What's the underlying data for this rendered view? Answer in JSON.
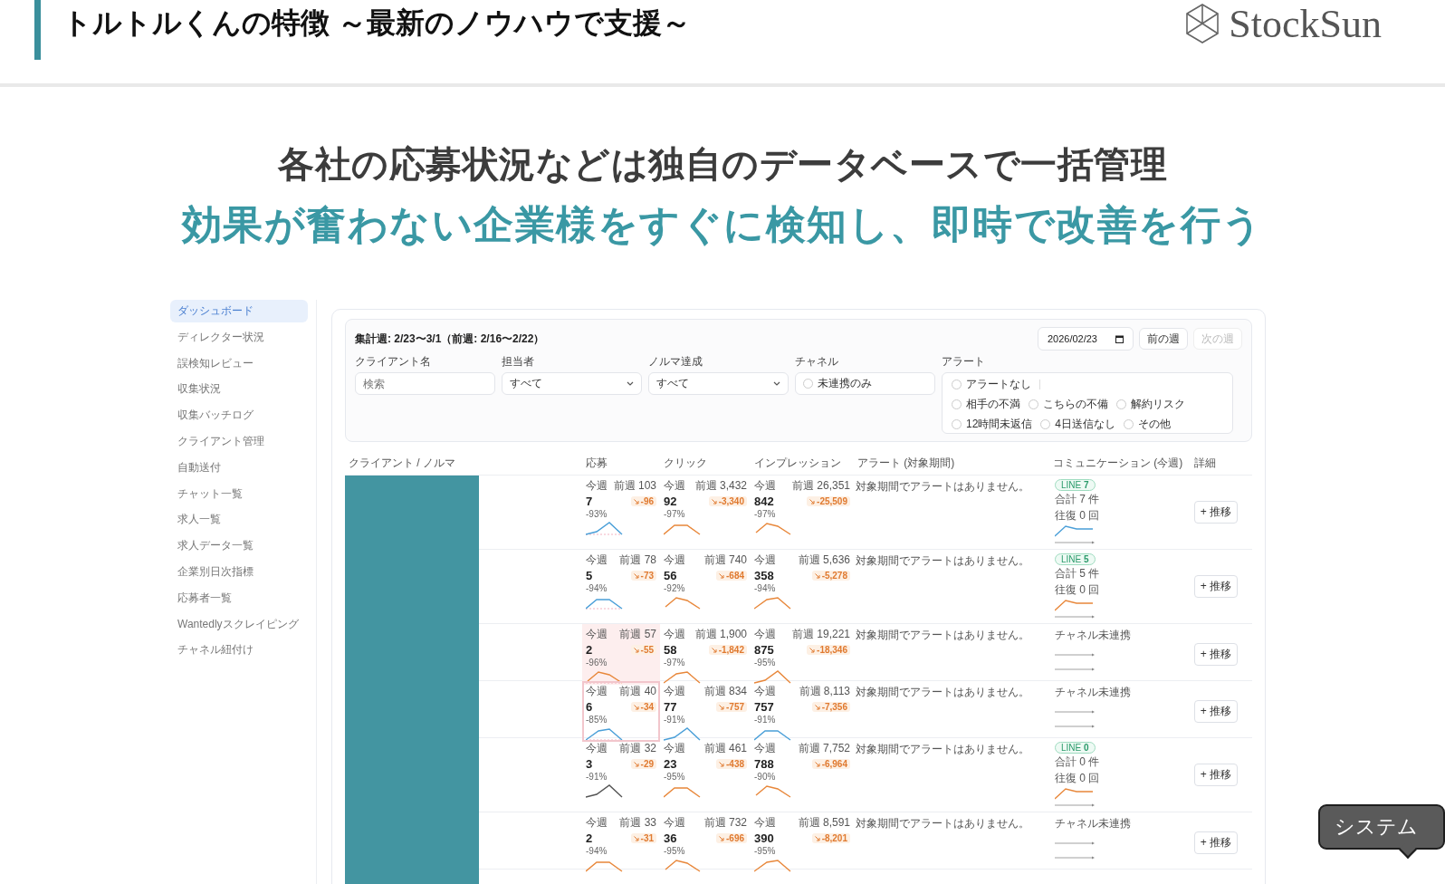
{
  "header": {
    "title": "トルトルくんの特徴 ～最新のノウハウで支援～",
    "logo": "StockSun"
  },
  "headline": {
    "line_1": "各社の応募状況などは独自のデータベースで一括管理",
    "line_2": "効果が奮わない企業様をすぐに検知し、即時で改善を行う"
  },
  "sidebar": {
    "items": [
      {
        "label": "ダッシュボード",
        "selected": true
      },
      {
        "label": "ディレクター状況",
        "selected": false
      },
      {
        "label": "誤検知レビュー",
        "selected": false
      },
      {
        "label": "収集状況",
        "selected": false
      },
      {
        "label": "収集バッチログ",
        "selected": false
      },
      {
        "label": "クライアント管理",
        "selected": false
      },
      {
        "label": "自動送付",
        "selected": false
      },
      {
        "label": "チャット一覧",
        "selected": false
      },
      {
        "label": "求人一覧",
        "selected": false
      },
      {
        "label": "求人データ一覧",
        "selected": false
      },
      {
        "label": "企業別日次指標",
        "selected": false
      },
      {
        "label": "応募者一覧",
        "selected": false
      },
      {
        "label": "Wantedlyスクレイピング",
        "selected": false
      },
      {
        "label": "チャネル紐付け",
        "selected": false
      }
    ]
  },
  "filters": {
    "period": "集計週: 2/23〜3/1（前週: 2/16〜2/22）",
    "date": "2026/02/23",
    "week_buttons": [
      {
        "label": "前の週",
        "disabled": false
      },
      {
        "label": "次の週",
        "disabled": true
      }
    ],
    "client_name": {
      "label": "クライアント名",
      "placeholder": "検索"
    },
    "owner": {
      "label": "担当者",
      "value": "すべて"
    },
    "quota": {
      "label": "ノルマ達成",
      "value": "すべて"
    },
    "channel": {
      "label": "チャネル",
      "option": {
        "label": "未連携のみ",
        "checked": false
      }
    },
    "alert": {
      "label": "アラート",
      "rows": [
        [
          {
            "label": "アラートなし",
            "checked": false
          }
        ],
        [
          {
            "label": "相手の不満",
            "checked": false
          },
          {
            "label": "こちらの不備",
            "checked": false
          },
          {
            "label": "解約リスク",
            "checked": false
          }
        ],
        [
          {
            "label": "12時間未返信",
            "checked": false
          },
          {
            "label": "4日送信なし",
            "checked": false
          },
          {
            "label": "その他",
            "checked": false
          }
        ]
      ]
    }
  },
  "table": {
    "columns": [
      "クライアント / ノルマ",
      "応募",
      "クリック",
      "インプレッション",
      "アラート (対象期間)",
      "コミュニケーション (今週)",
      "詳細"
    ],
    "rows": [
      {
        "metrics": [
          {
            "this_week": "今週",
            "prev": "前週 103",
            "value": "7",
            "delta": "-96",
            "pct": "-93%",
            "color": "#4a9fd8",
            "flagged": false,
            "selected": false
          },
          {
            "this_week": "今週",
            "prev": "前週 3,432",
            "value": "92",
            "delta": "-3,340",
            "pct": "-97%",
            "color": "#e8873a",
            "flagged": false,
            "selected": false
          },
          {
            "this_week": "今週",
            "prev": "前週 26,351",
            "value": "842",
            "delta": "-25,509",
            "pct": "-97%",
            "color": "#e8873a",
            "flagged": false,
            "selected": false
          }
        ],
        "alert": "対象期間でアラートはありません。",
        "comm": {
          "kind": "line",
          "badge": "LINE **7**",
          "total": "合計 7 件",
          "round": "往復 0 回",
          "color": "#4a9fd8"
        },
        "detail": "+ 推移"
      },
      {
        "metrics": [
          {
            "this_week": "今週",
            "prev": "前週 78",
            "value": "5",
            "delta": "-73",
            "pct": "-94%",
            "color": "#4a9fd8",
            "flagged": false,
            "selected": false
          },
          {
            "this_week": "今週",
            "prev": "前週 740",
            "value": "56",
            "delta": "-684",
            "pct": "-92%",
            "color": "#e8873a",
            "flagged": false,
            "selected": false
          },
          {
            "this_week": "今週",
            "prev": "前週 5,636",
            "value": "358",
            "delta": "-5,278",
            "pct": "-94%",
            "color": "#e8873a",
            "flagged": false,
            "selected": false
          }
        ],
        "alert": "対象期間でアラートはありません。",
        "comm": {
          "kind": "line",
          "badge": "LINE **5**",
          "total": "合計 5 件",
          "round": "往復 0 回",
          "color": "#e8873a"
        },
        "detail": "+ 推移"
      },
      {
        "metrics": [
          {
            "this_week": "今週",
            "prev": "前週 57",
            "value": "2",
            "delta": "-55",
            "pct": "-96%",
            "color": "#e8873a",
            "flagged": true,
            "selected": false
          },
          {
            "this_week": "今週",
            "prev": "前週 1,900",
            "value": "58",
            "delta": "-1,842",
            "pct": "-97%",
            "color": "#e8873a",
            "flagged": false,
            "selected": false
          },
          {
            "this_week": "今週",
            "prev": "前週 19,221",
            "value": "875",
            "delta": "-18,346",
            "pct": "-95%",
            "color": "#e8873a",
            "flagged": false,
            "selected": false
          }
        ],
        "alert": "対象期間でアラートはありません。",
        "comm": {
          "kind": "unlinked",
          "label": "チャネル未連携"
        },
        "detail": "+ 推移"
      },
      {
        "metrics": [
          {
            "this_week": "今週",
            "prev": "前週 40",
            "value": "6",
            "delta": "-34",
            "pct": "-85%",
            "color": "#4a9fd8",
            "flagged": false,
            "selected": true
          },
          {
            "this_week": "今週",
            "prev": "前週 834",
            "value": "77",
            "delta": "-757",
            "pct": "-91%",
            "color": "#4a9fd8",
            "flagged": false,
            "selected": false
          },
          {
            "this_week": "今週",
            "prev": "前週 8,113",
            "value": "757",
            "delta": "-7,356",
            "pct": "-91%",
            "color": "#4a9fd8",
            "flagged": false,
            "selected": false
          }
        ],
        "alert": "対象期間でアラートはありません。",
        "comm": {
          "kind": "unlinked",
          "label": "チャネル未連携"
        },
        "detail": "+ 推移"
      },
      {
        "metrics": [
          {
            "this_week": "今週",
            "prev": "前週 32",
            "value": "3",
            "delta": "-29",
            "pct": "-91%",
            "color": "#555555",
            "flagged": false,
            "selected": false
          },
          {
            "this_week": "今週",
            "prev": "前週 461",
            "value": "23",
            "delta": "-438",
            "pct": "-95%",
            "color": "#e8873a",
            "flagged": false,
            "selected": false
          },
          {
            "this_week": "今週",
            "prev": "前週 7,752",
            "value": "788",
            "delta": "-6,964",
            "pct": "-90%",
            "color": "#e8873a",
            "flagged": false,
            "selected": false
          }
        ],
        "alert": "対象期間でアラートはありません。",
        "comm": {
          "kind": "line",
          "badge": "LINE **0**",
          "total": "合計 0 件",
          "round": "往復 0 回",
          "color": "#e8873a"
        },
        "detail": "+ 推移"
      },
      {
        "metrics": [
          {
            "this_week": "今週",
            "prev": "前週 33",
            "value": "2",
            "delta": "-31",
            "pct": "-94%",
            "color": "#e8873a",
            "flagged": false,
            "selected": false
          },
          {
            "this_week": "今週",
            "prev": "前週 732",
            "value": "36",
            "delta": "-696",
            "pct": "-95%",
            "color": "#e8873a",
            "flagged": false,
            "selected": false
          },
          {
            "this_week": "今週",
            "prev": "前週 8,591",
            "value": "390",
            "delta": "-8,201",
            "pct": "-95%",
            "color": "#e8873a",
            "flagged": false,
            "selected": false
          }
        ],
        "alert": "対象期間でアラートはありません。",
        "comm": {
          "kind": "unlinked",
          "label": "チャネル未連携"
        },
        "detail": "+ 推移"
      }
    ]
  },
  "tooltip": "システム"
}
